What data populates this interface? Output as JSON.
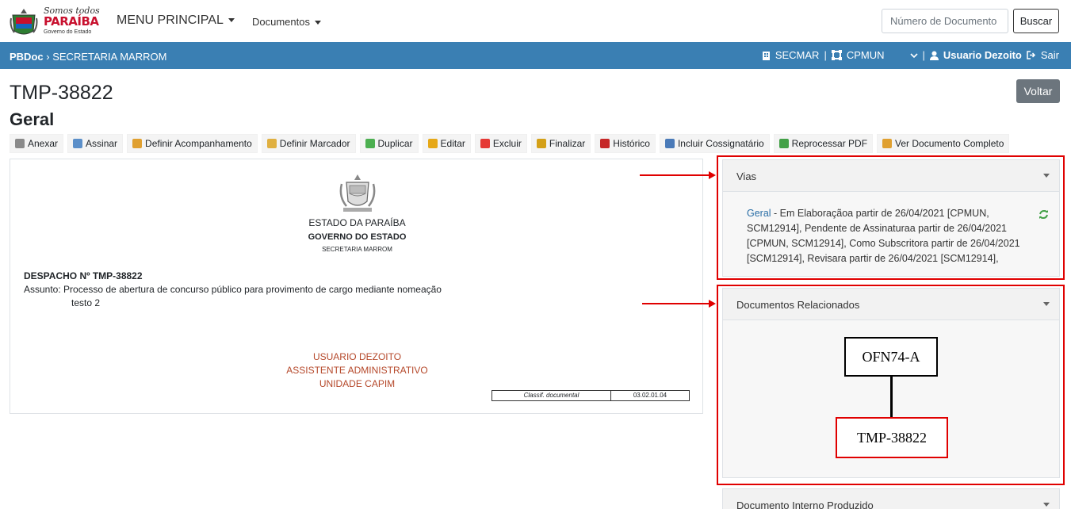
{
  "header": {
    "logo": {
      "line1": "Somos todos",
      "line2": "PARAÍBA",
      "line3": "Governo do Estado"
    },
    "menu_main": "MENU PRINCIPAL",
    "menu_docs": "Documentos",
    "search": {
      "placeholder": "Número de Documento",
      "button": "Buscar"
    }
  },
  "bluebar": {
    "brand": "PBDoc",
    "section": "SECRETARIA MARROM",
    "org": "SECMAR",
    "unit": "CPMUN",
    "user": "Usuario Dezoito",
    "logout": "Sair"
  },
  "page": {
    "doc_id": "TMP-38822",
    "doc_via": "Geral",
    "back_button": "Voltar"
  },
  "toolbar": [
    {
      "label": "Anexar",
      "icon": "paperclip-icon",
      "color": "#8a8a8a"
    },
    {
      "label": "Assinar",
      "icon": "sign-icon",
      "color": "#5b8fc9"
    },
    {
      "label": "Definir Acompanhamento",
      "icon": "follow-icon",
      "color": "#e0a030"
    },
    {
      "label": "Definir Marcador",
      "icon": "marker-icon",
      "color": "#e0b040"
    },
    {
      "label": "Duplicar",
      "icon": "duplicate-icon",
      "color": "#4caf50"
    },
    {
      "label": "Editar",
      "icon": "pencil-icon",
      "color": "#e6a817"
    },
    {
      "label": "Excluir",
      "icon": "delete-icon",
      "color": "#e53935"
    },
    {
      "label": "Finalizar",
      "icon": "lock-icon",
      "color": "#d4a017"
    },
    {
      "label": "Histórico",
      "icon": "calendar-icon",
      "color": "#c62828"
    },
    {
      "label": "Incluir Cossignatário",
      "icon": "user-add-icon",
      "color": "#4a7ab8"
    },
    {
      "label": "Reprocessar PDF",
      "icon": "refresh-icon",
      "color": "#43a047"
    },
    {
      "label": "Ver Documento Completo",
      "icon": "document-icon",
      "color": "#e0a030"
    }
  ],
  "document": {
    "state": "ESTADO DA PARAÍBA",
    "gov": "GOVERNO DO ESTADO",
    "secretaria": "SECRETARIA MARROM",
    "title": "DESPACHO Nº TMP-38822",
    "subject": "Assunto: Processo de abertura de concurso público para provimento de cargo mediante nomeação",
    "body": "testo 2",
    "signer_name": "USUARIO DEZOITO",
    "signer_role": "ASSISTENTE ADMINISTRATIVO",
    "signer_unit": "UNIDADE CAPIM",
    "classif_label": "Classif. documental",
    "classif_value": "03.02.01.04"
  },
  "vias": {
    "title": "Vias",
    "link": "Geral",
    "text": " -  Em Elaboraçãoa partir de 26/04/2021 [CPMUN, SCM12914], Pendente de Assinaturaa partir de 26/04/2021 [CPMUN, SCM12914], Como Subscritora partir de 26/04/2021 [SCM12914], Revisara partir de 26/04/2021 [SCM12914],"
  },
  "related": {
    "title": "Documentos Relacionados",
    "parent": "OFN74-A",
    "child": "TMP-38822"
  },
  "produced": {
    "title": "Documento Interno Produzido"
  },
  "colors": {
    "bluebar": "#3a7fb3",
    "highlight": "#e00000",
    "signature": "#b5482a"
  }
}
